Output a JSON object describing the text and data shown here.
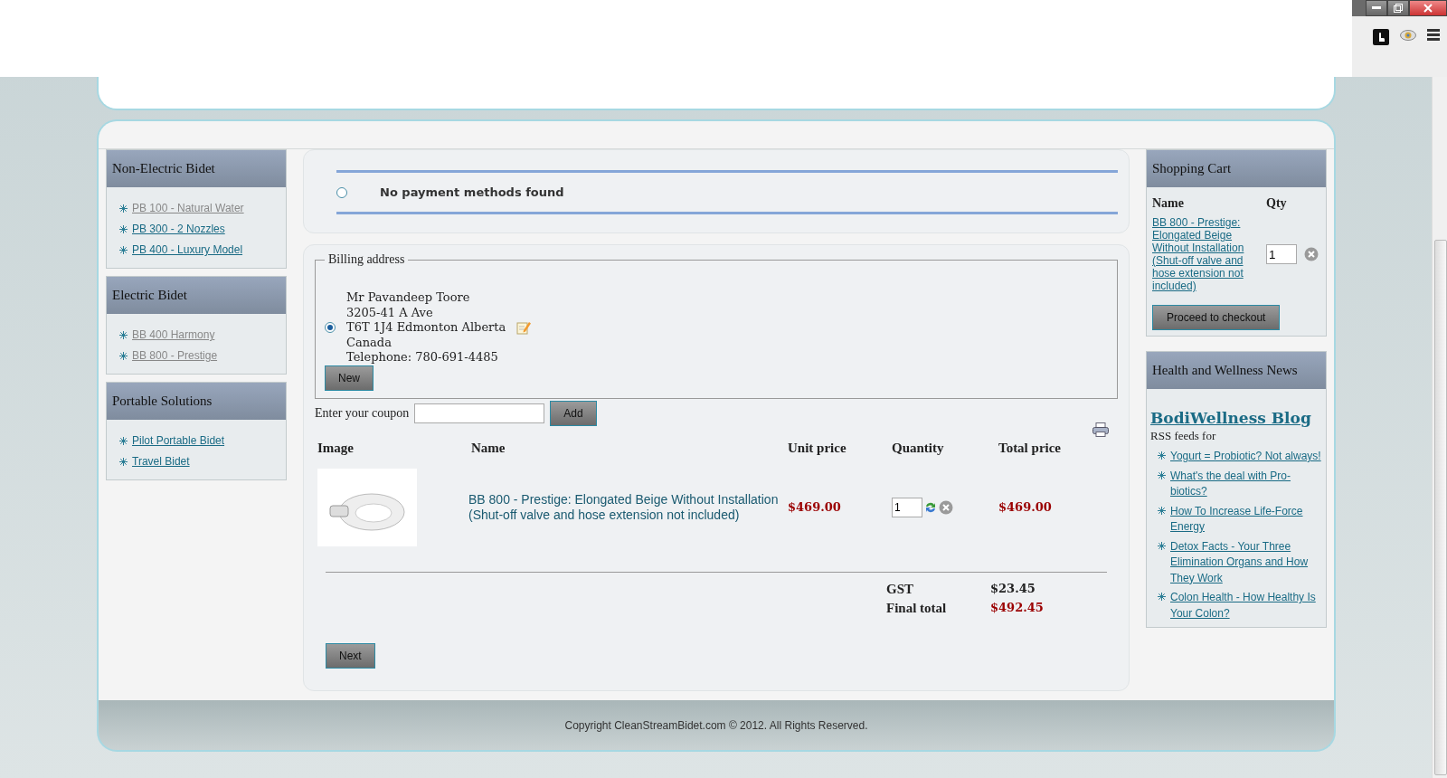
{
  "sidebar": [
    {
      "title": "Non-Electric Bidet",
      "items": [
        {
          "label": "PB 100 - Natural Water",
          "visited": true
        },
        {
          "label": "PB 300 - 2 Nozzles",
          "visited": false
        },
        {
          "label": "PB 400 - Luxury Model",
          "visited": false
        }
      ]
    },
    {
      "title": "Electric Bidet",
      "items": [
        {
          "label": "BB 400 Harmony",
          "visited": true
        },
        {
          "label": "BB 800 - Prestige",
          "visited": true
        }
      ]
    },
    {
      "title": "Portable Solutions",
      "items": [
        {
          "label": "Pilot Portable Bidet",
          "visited": false
        },
        {
          "label": "Travel Bidet",
          "visited": false
        }
      ]
    }
  ],
  "payment": {
    "message": "No payment methods found",
    "selected": false
  },
  "billing": {
    "legend": "Billing address",
    "selected": true,
    "lines": [
      "Mr Pavandeep Toore",
      "3205-41 A Ave",
      "T6T 1J4 Edmonton Alberta",
      "Canada",
      "Telephone: 780-691-4485"
    ],
    "new_button": "New"
  },
  "coupon": {
    "label": "Enter your coupon",
    "button": "Add"
  },
  "table": {
    "columns": [
      "Image",
      "Name",
      "Unit price",
      "Quantity",
      "Total price"
    ],
    "rows": [
      {
        "name": "BB 800 - Prestige: Elongated Beige Without Installation (Shut-off valve and hose extension not included)",
        "unit_price": "$469.00",
        "quantity": "1",
        "total_price": "$469.00"
      }
    ]
  },
  "totals": [
    {
      "label": "GST",
      "value": "$23.45",
      "kind": "plain"
    },
    {
      "label": "Final total",
      "value": "$492.45",
      "kind": "highlight"
    }
  ],
  "next_button": "Next",
  "cart": {
    "title": "Shopping Cart",
    "columns": [
      "Name",
      "Qty"
    ],
    "items": [
      {
        "name": "BB 800 - Prestige: Elongated Beige Without Installation (Shut-off valve and hose extension not included)",
        "qty": "1"
      }
    ],
    "checkout_button": "Proceed to checkout"
  },
  "news": {
    "title": "Health and Wellness News",
    "blog": "BodiWellness Blog",
    "subtitle": "RSS feeds for",
    "items": [
      "Yogurt = Probiotic? Not always!",
      "What's the deal with Pro-biotics?",
      "How To Increase Life-Force Energy",
      "Detox Facts - Your Three Elimination Organs and How They Work",
      "Colon Health - How Healthy Is Your Colon?"
    ]
  },
  "footer": "Copyright CleanStreamBidet.com © 2012. All Rights Reserved."
}
